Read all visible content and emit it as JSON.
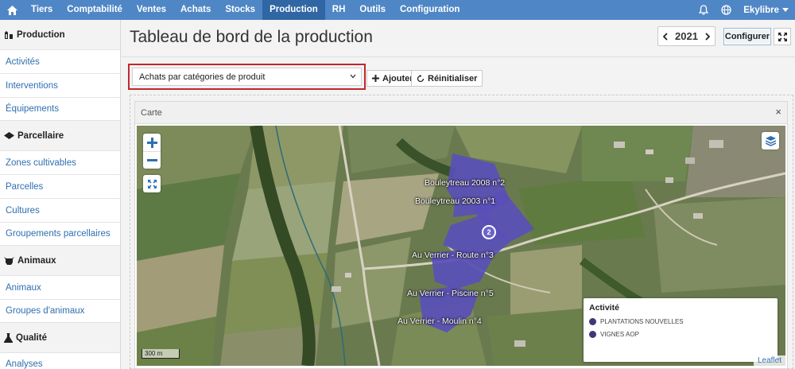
{
  "topnav": {
    "items": [
      "Tiers",
      "Comptabilité",
      "Ventes",
      "Achats",
      "Stocks",
      "Production",
      "RH",
      "Outils",
      "Configuration"
    ],
    "active": "Production",
    "user": "Ekylibre",
    "icons": [
      "home-icon",
      "bell-icon",
      "globe-icon",
      "caret-down-icon"
    ]
  },
  "sidebar": {
    "sections": [
      {
        "title": "Production",
        "icon": "production-icon",
        "items": [
          "Activités",
          "Interventions",
          "Équipements"
        ]
      },
      {
        "title": "Parcellaire",
        "icon": "parcel-icon",
        "items": [
          "Zones cultivables",
          "Parcelles",
          "Cultures",
          "Groupements parcellaires"
        ]
      },
      {
        "title": "Animaux",
        "icon": "cow-icon",
        "items": [
          "Animaux",
          "Groupes d'animaux"
        ]
      },
      {
        "title": "Qualité",
        "icon": "flask-icon",
        "items": [
          "Analyses"
        ]
      }
    ]
  },
  "header": {
    "title": "Tableau de bord de la production",
    "year": "2021",
    "configure_label": "Configurer"
  },
  "toolbar": {
    "select_value": "Achats par catégories de produit",
    "add_label": "Ajouter",
    "reset_label": "Réinitialiser"
  },
  "card": {
    "title": "Carte",
    "close": "×"
  },
  "map": {
    "parcels": [
      {
        "label": "Bouleytreau 2008 n°2"
      },
      {
        "label": "Bouleytreau 2003 n°1"
      },
      {
        "label": "Au Verrier - Route n°3"
      },
      {
        "label": "Au Verrier - Piscine n°5"
      },
      {
        "label": "Au Verrier - Moulin n°4"
      }
    ],
    "cluster_count": "2",
    "scale": "300 m",
    "attribution": "Leaflet",
    "parcel_color": "#5a4fb8"
  },
  "legend": {
    "title": "Activité",
    "items": [
      {
        "label": "PLANTATIONS NOUVELLES",
        "color": "#3f3779"
      },
      {
        "label": "VIGNES AOP",
        "color": "#3f3779"
      }
    ]
  }
}
